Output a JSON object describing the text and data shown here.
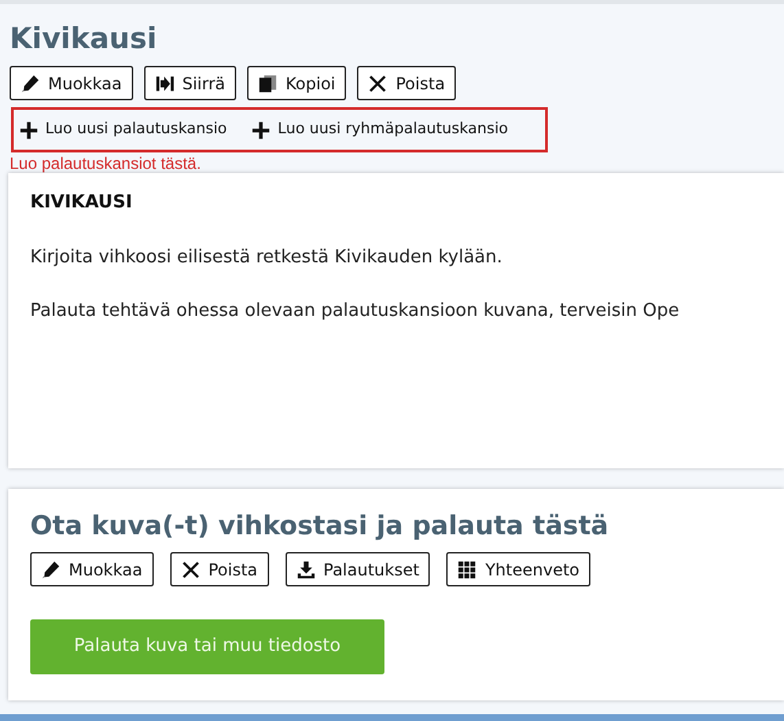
{
  "header": {
    "title": "Kivikausi",
    "buttons": [
      {
        "kind": "edit",
        "label": "Muokkaa"
      },
      {
        "kind": "move",
        "label": "Siirrä"
      },
      {
        "kind": "copy",
        "label": "Kopioi"
      },
      {
        "kind": "delete",
        "label": "Poista"
      }
    ],
    "create_links": [
      {
        "label": "Luo uusi palautuskansio"
      },
      {
        "label": "Luo uusi ryhmäpalautuskansio"
      }
    ],
    "hint": "Luo palautuskansiot tästä."
  },
  "content": {
    "heading": "KIVIKAUSI",
    "paragraphs": [
      "Kirjoita vihkoosi eilisestä retkestä Kivikauden kylään.",
      "Palauta tehtävä ohessa olevaan palautuskansioon kuvana, terveisin Ope"
    ]
  },
  "return_folder": {
    "title": "Ota kuva(-t) vihkostasi ja palauta tästä",
    "buttons": [
      {
        "kind": "edit",
        "label": "Muokkaa"
      },
      {
        "kind": "delete",
        "label": "Poista"
      },
      {
        "kind": "returns",
        "label": "Palautukset"
      },
      {
        "kind": "summary",
        "label": "Yhteenveto"
      }
    ],
    "submit_button": "Palauta kuva tai muu tiedosto"
  }
}
